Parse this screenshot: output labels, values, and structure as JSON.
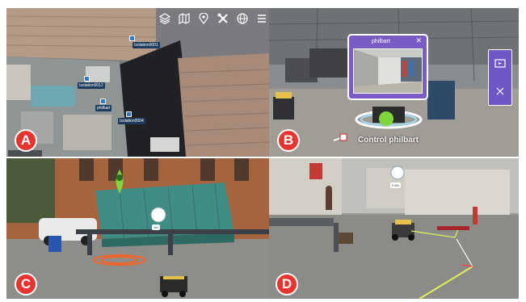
{
  "panels": {
    "a": {
      "letter": "A"
    },
    "b": {
      "letter": "B"
    },
    "c": {
      "letter": "C"
    },
    "d": {
      "letter": "D"
    }
  },
  "map": {
    "toolbar": [
      "layers-icon",
      "map-icon",
      "place-pin-icon",
      "tools-icon",
      "globe-icon",
      "menu-icon"
    ],
    "markers": [
      {
        "label": "Isolation0001"
      },
      {
        "label": "Isolation0012"
      },
      {
        "label": "philbart"
      },
      {
        "label": "Isolation0004"
      }
    ]
  },
  "ar": {
    "window_title": "philbart",
    "control_label": "Control philbart"
  },
  "field_tags": {
    "c_tag": "1m",
    "d_tag": "0.5m"
  },
  "colors": {
    "accent": "#e8342f",
    "hud_purple": "#7a5cc4",
    "ring_orange": "#f0642a",
    "sphere_green": "#7ed63b"
  }
}
